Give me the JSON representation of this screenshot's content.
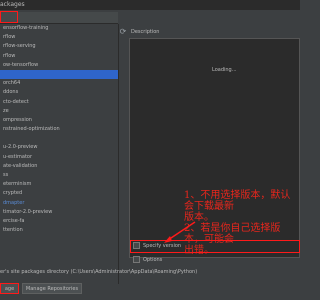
{
  "window": {
    "title": "ackages"
  },
  "packages": [
    "ensorflow-training",
    "rflow",
    "rflow-serving",
    "rflow",
    "ow-tensorflow",
    "",
    "orch64",
    "ddons",
    "cto-detect",
    "ze",
    "ompression",
    "nstrained-optimization",
    "",
    "u-2.0-preview",
    "u-estimator",
    "ate-validation",
    "ss",
    "eterminism",
    "crypted",
    "dmapter",
    "timator-2.0-preview",
    "ercise-fa",
    "ttention",
    ""
  ],
  "selected_index": 5,
  "link_index": 19,
  "refresh_icon": "refresh-icon",
  "description": {
    "label": "Description",
    "loading": "Loading..."
  },
  "annotation": {
    "line1": "1、不用选择版本，默认会下载最新",
    "line2": "版本。",
    "line3": "2、若是你自己选择版本，可能会",
    "line4": "出错。"
  },
  "options": {
    "specify_version": "Specify version",
    "options": "Options"
  },
  "install_path": "er's site packages directory (C:\\Users\\Administrator\\AppData\\Roaming\\Python)",
  "buttons": {
    "install": "age",
    "manage": "Manage Repositories"
  },
  "highlight_color": "#ff1a1a"
}
